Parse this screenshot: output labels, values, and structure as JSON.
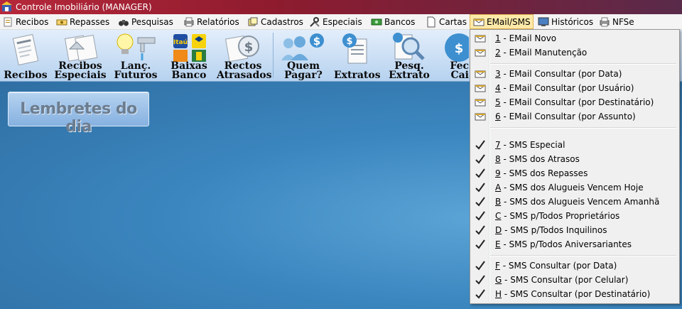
{
  "window": {
    "title": "Controle Imobiliário (MANAGER)"
  },
  "menubar": {
    "items": [
      {
        "label": "Recibos",
        "icon": "receipt-icon"
      },
      {
        "label": "Repasses",
        "icon": "transfer-icon"
      },
      {
        "label": "Pesquisas",
        "icon": "binoculars-icon"
      },
      {
        "label": "Relatórios",
        "icon": "printer-icon"
      },
      {
        "label": "Cadastros",
        "icon": "records-icon"
      },
      {
        "label": "Especiais",
        "icon": "tools-icon"
      },
      {
        "label": "Bancos",
        "icon": "money-icon"
      },
      {
        "label": "Cartas",
        "icon": "document-icon"
      },
      {
        "label": "EMail/SMS",
        "icon": "envelope-icon"
      },
      {
        "label": "Históricos",
        "icon": "monitor-icon"
      },
      {
        "label": "NFSe",
        "icon": "printer-icon"
      }
    ]
  },
  "toolbar": {
    "buttons": [
      {
        "label1": "Recibos",
        "label2": ""
      },
      {
        "label1": "Recibos",
        "label2": "Especiais"
      },
      {
        "label1": "Lanç.",
        "label2": "Futuros"
      },
      {
        "label1": "Baixas",
        "label2": "Banco"
      },
      {
        "label1": "Rectos",
        "label2": "Atrasados"
      },
      {
        "label1": "Quem",
        "label2": "Pagar?"
      },
      {
        "label1": "Extratos",
        "label2": ""
      },
      {
        "label1": "Pesq.",
        "label2": "Extrato"
      },
      {
        "label1": "Fec",
        "label2": "Cai"
      }
    ],
    "bank_badge": "Itaú"
  },
  "lembretes": {
    "label": "Lembretes do dia"
  },
  "dropdown": {
    "email_items": [
      {
        "key": "1",
        "text": " - EMail Novo"
      },
      {
        "key": "2",
        "text": " - EMail Manutenção"
      },
      {
        "key": "3",
        "text": " - EMail Consultar (por Data)"
      },
      {
        "key": "4",
        "text": " - EMail Consultar (por Usuário)"
      },
      {
        "key": "5",
        "text": " - EMail Consultar (por Destinatário)"
      },
      {
        "key": "6",
        "text": " - EMail Consultar (por Assunto)"
      }
    ],
    "sms_items": [
      {
        "key": "7",
        "text": " - SMS Especial"
      },
      {
        "key": "8",
        "text": " - SMS dos Atrasos"
      },
      {
        "key": "9",
        "text": " - SMS dos Repasses"
      },
      {
        "key": "A",
        "text": " - SMS dos Alugueis Vencem Hoje"
      },
      {
        "key": "B",
        "text": " - SMS dos Alugueis Vencem Amanhã"
      },
      {
        "key": "C",
        "text": " - SMS p/Todos Proprietários"
      },
      {
        "key": "D",
        "text": " - SMS p/Todos Inquilinos"
      },
      {
        "key": "E",
        "text": " - SMS p/Todos Aniversariantes"
      },
      {
        "key": "F",
        "text": " - SMS Consultar (por Data)"
      },
      {
        "key": "G",
        "text": " - SMS Consultar (por Celular)"
      },
      {
        "key": "H",
        "text": " - SMS Consultar (por Destinatário)"
      }
    ]
  },
  "colors": {
    "accent": "#fde9a8",
    "title_bar": "#b6283a",
    "desktop": "#3f82b6"
  }
}
